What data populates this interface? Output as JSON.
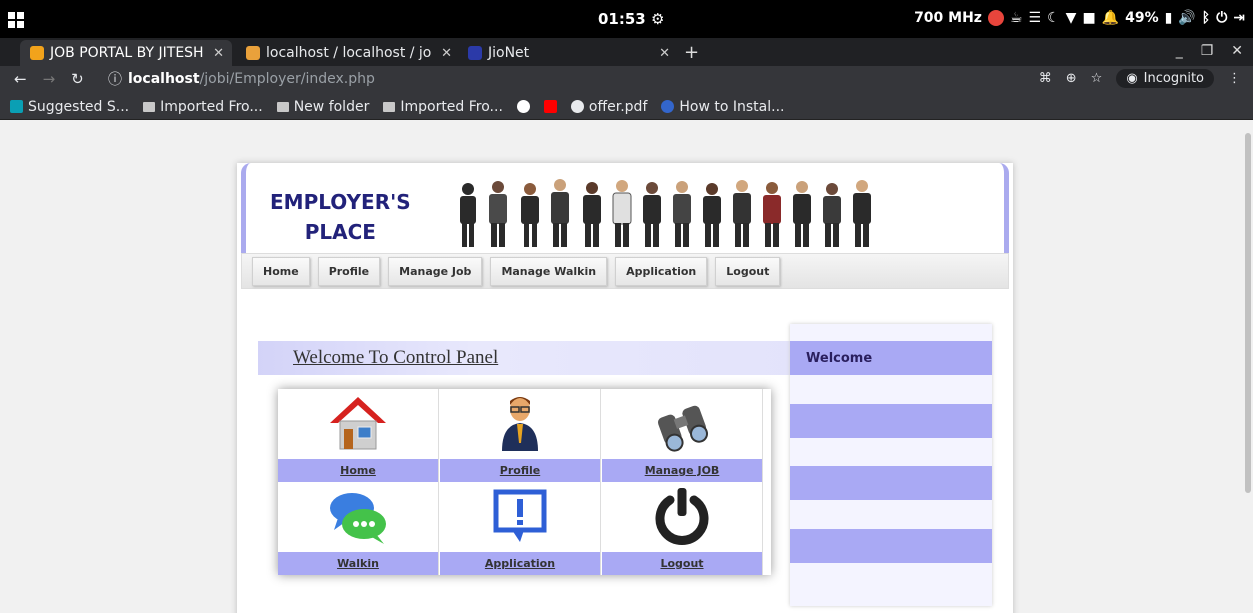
{
  "os": {
    "clock": "01:53",
    "cpu": "700 MHz",
    "battery": "49%"
  },
  "tabs": [
    {
      "title": "JOB PORTAL BY JITESH",
      "active": true,
      "favicon_color": "#f2a31b"
    },
    {
      "title": "localhost / localhost / jo",
      "active": false,
      "favicon_color": "#e9a13b"
    },
    {
      "title": "JioNet",
      "active": false,
      "favicon_color": "#2b3aa8"
    }
  ],
  "toolbar": {
    "url_host": "localhost",
    "url_path": "/jobi/Employer/index.php",
    "incognito_label": "Incognito"
  },
  "bookmarks": [
    {
      "label": "Suggested S...",
      "icon": "bing-icon",
      "color": "#0a9fb4"
    },
    {
      "label": "Imported Fro...",
      "icon": "folder-icon",
      "color": "#c8c8c8"
    },
    {
      "label": "New folder",
      "icon": "folder-icon",
      "color": "#c8c8c8"
    },
    {
      "label": "Imported Fro...",
      "icon": "folder-icon",
      "color": "#c8c8c8"
    },
    {
      "label": "",
      "icon": "google-icon",
      "color": "#ffffff"
    },
    {
      "label": "",
      "icon": "youtube-icon",
      "color": "#ff0000"
    },
    {
      "label": "offer.pdf",
      "icon": "globe-icon",
      "color": "#e8eaed"
    },
    {
      "label": "How to Instal...",
      "icon": "site-icon",
      "color": "#3366cc"
    }
  ],
  "site": {
    "banner_title_line1": "EMPLOYER'S",
    "banner_title_line2": "PLACE",
    "menu": [
      "Home",
      "Profile",
      "Manage Job",
      "Manage Walkin",
      "Application",
      "Logout"
    ],
    "welcome_heading": "Welcome To Control Panel",
    "tiles": [
      {
        "label": "Home",
        "icon": "house-icon"
      },
      {
        "label": "Profile",
        "icon": "businessman-icon"
      },
      {
        "label": "Manage JOB",
        "icon": "binoculars-icon"
      },
      {
        "label": "Walkin",
        "icon": "chat-bubbles-icon"
      },
      {
        "label": "Application",
        "icon": "alert-message-icon"
      },
      {
        "label": "Logout",
        "icon": "power-icon"
      }
    ],
    "sidebar_welcome": "Welcome"
  },
  "colors": {
    "accent": "#a9a9f4",
    "banner_text": "#22227a"
  }
}
